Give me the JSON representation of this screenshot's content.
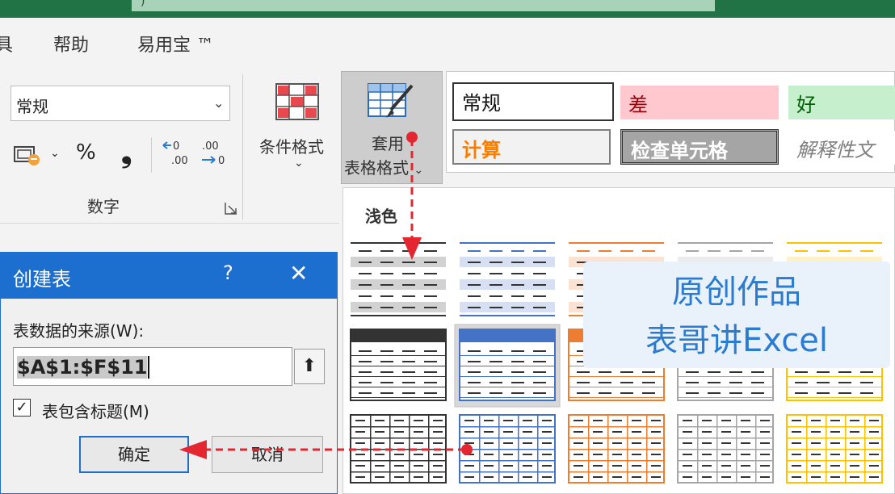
{
  "title_fragment": ")",
  "menu": {
    "tools_partial": "具",
    "help": "帮助",
    "addin": "易用宝 ™"
  },
  "ribbon": {
    "number_format_value": "常规",
    "percent_symbol": "%",
    "comma_symbol": "❟",
    "increase_decimal_label": "←0\n.00",
    "decrease_decimal_label": ".00\n→0",
    "number_group_label": "数字",
    "conditional_format_label": "条件格式",
    "table_format_line1": "套用",
    "table_format_line2": "表格格式",
    "cell_styles": [
      {
        "label": "常规",
        "fg": "#111111",
        "bg": "#ffffff"
      },
      {
        "label": "差",
        "fg": "#9c0006",
        "bg": "#ffc7ce"
      },
      {
        "label": "好",
        "fg": "#006100",
        "bg": "#c6efce"
      },
      {
        "label": "计算",
        "fg": "#fa7d00",
        "bg": "#f2f2f2"
      },
      {
        "label": "检查单元格",
        "fg": "#ffffff",
        "bg": "#a5a5a5"
      },
      {
        "label": "解释性文",
        "fg": "#7f7f7f",
        "bg": "#ffffff"
      }
    ]
  },
  "dropdown": {
    "section_label": "浅色",
    "style_colors": [
      "#333333",
      "#4472c4",
      "#ed7d31",
      "#a5a5a5",
      "#ffc000"
    ]
  },
  "watermark": {
    "line1": "原创作品",
    "line2": "表哥讲Excel"
  },
  "dialog": {
    "title": "创建表",
    "help": "?",
    "close": "✕",
    "source_label": "表数据的来源(W):",
    "range_value": "$A$1:$F$11",
    "has_headers_label": "表包含标题(M)",
    "has_headers_checked": true,
    "ok_label": "确定",
    "cancel_label": "取消"
  },
  "colors": {
    "excel_green": "#217346",
    "dialog_blue": "#1d6fcf",
    "annotation_red": "#e3262f"
  }
}
